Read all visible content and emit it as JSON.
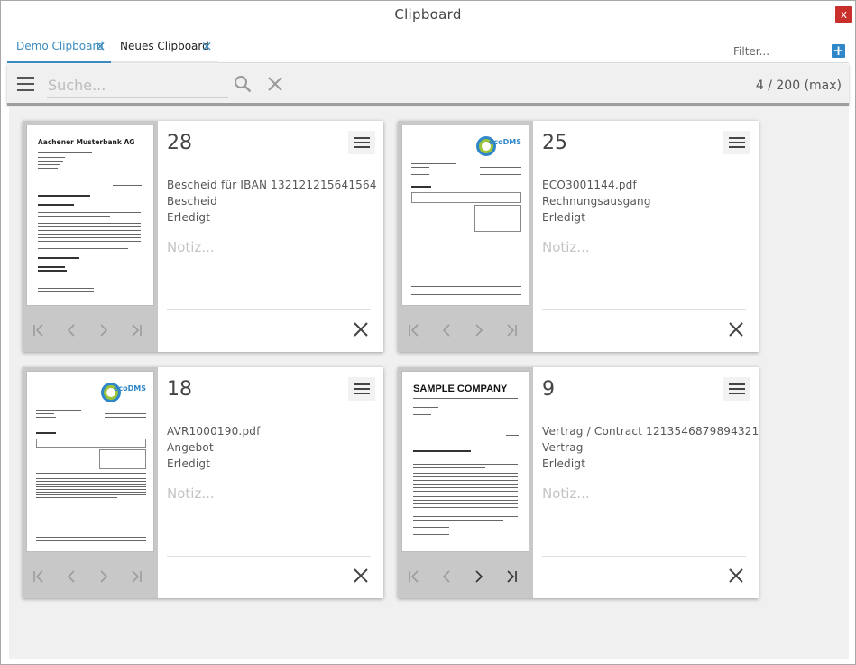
{
  "window": {
    "title": "Clipboard",
    "close_symbol": "x"
  },
  "tabs": [
    {
      "label": "Demo Clipboard",
      "active": true,
      "close_symbol": "×"
    },
    {
      "label": "Neues Clipboard",
      "active": false,
      "close_symbol": "×"
    }
  ],
  "filter": {
    "placeholder": "Filter...",
    "add_symbol": "+"
  },
  "toolbar": {
    "search_placeholder": "Suche...",
    "count": "4 / 200 (max)"
  },
  "cards": [
    {
      "number": "28",
      "lines": [
        "Bescheid für IBAN 132121215641564",
        "Bescheid",
        "Erledigt"
      ],
      "notiz": "Notiz...",
      "thumb": {
        "company": "Aachener Musterbank AG"
      }
    },
    {
      "number": "25",
      "lines": [
        "ECO3001144.pdf",
        "Rechnungsausgang",
        "Erledigt"
      ],
      "notiz": "Notiz...",
      "thumb": {
        "logo": "ecoDMS"
      }
    },
    {
      "number": "18",
      "lines": [
        "AVR1000190.pdf",
        "Angebot",
        "Erledigt"
      ],
      "notiz": "Notiz...",
      "thumb": {
        "logo": "ecoDMS"
      }
    },
    {
      "number": "9",
      "lines": [
        "Vertrag / Contract 1213546879894321",
        "Vertrag",
        "Erledigt"
      ],
      "notiz": "Notiz...",
      "thumb": {
        "company": "SAMPLE COMPANY"
      }
    }
  ],
  "colors": {
    "accent": "#3b8bc0",
    "close_red": "#c9302c",
    "add_blue": "#2f86c9"
  }
}
